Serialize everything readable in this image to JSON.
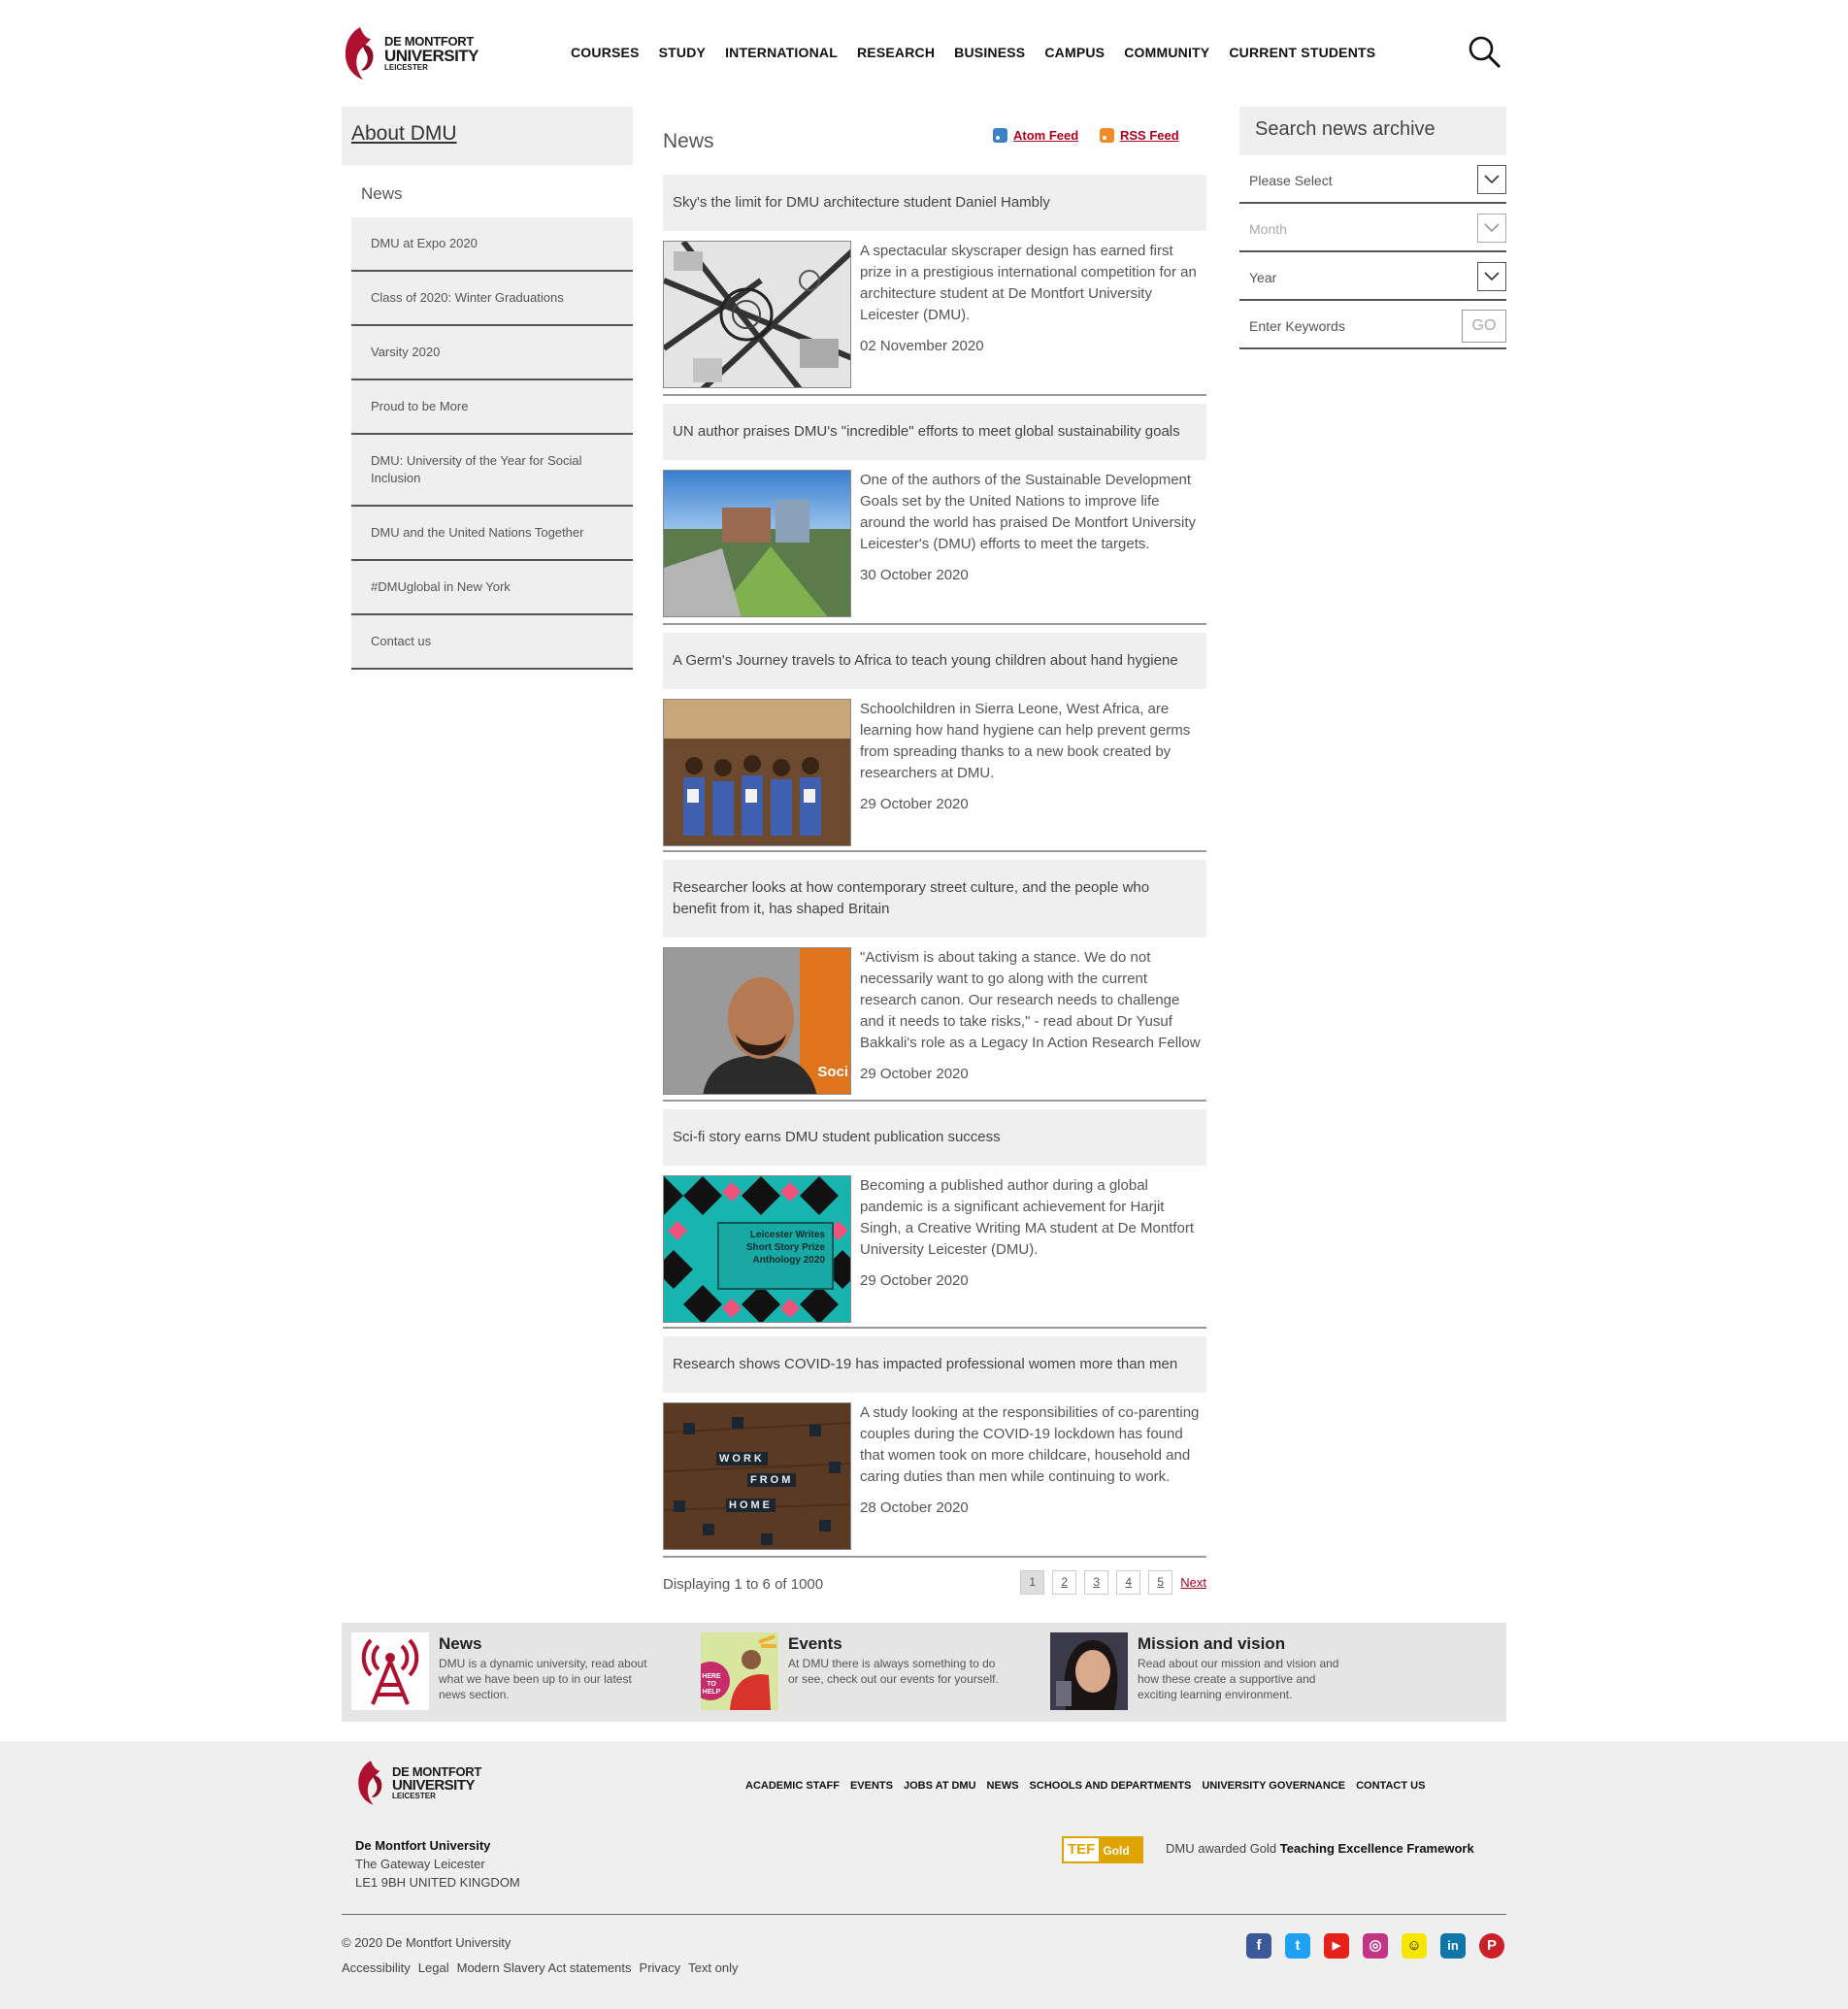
{
  "header": {
    "logo": {
      "line1": "DE MONTFORT",
      "line2": "UNIVERSITY",
      "line3": "LEICESTER"
    },
    "nav": [
      "COURSES",
      "STUDY",
      "INTERNATIONAL",
      "RESEARCH",
      "BUSINESS",
      "CAMPUS",
      "COMMUNITY",
      "CURRENT STUDENTS"
    ],
    "search_icon": "search-icon"
  },
  "sidebar": {
    "about": "About DMU",
    "section": "News",
    "items": [
      "DMU at Expo 2020",
      "Class of 2020: Winter Graduations",
      "Varsity 2020",
      "Proud to be More",
      "DMU: University of the Year for Social Inclusion",
      "DMU and the United Nations Together",
      "#DMUglobal in New York",
      "Contact us"
    ]
  },
  "news": {
    "title": "News",
    "atom": "Atom Feed",
    "rss": "RSS Feed",
    "articles": [
      {
        "headline": "Sky's the limit for DMU architecture student Daniel Hambly",
        "summary": "A spectacular skyscraper design has earned first prize in a prestigious international competition for an architecture student at De Montfort University Leicester (DMU).",
        "date": "02 November 2020"
      },
      {
        "headline": "UN author praises DMU's \"incredible\" efforts to meet global sustainability goals",
        "summary": "One of the authors of the Sustainable Development Goals set by the United Nations to improve life around the world has praised De Montfort University Leicester's (DMU) efforts to meet the targets.",
        "date": "30 October 2020"
      },
      {
        "headline": "A Germ's Journey travels to Africa to teach young children about hand hygiene",
        "summary": "Schoolchildren in Sierra Leone, West Africa, are learning how hand hygiene can help prevent germs from spreading thanks to a new book created by researchers at DMU.",
        "date": "29 October 2020"
      },
      {
        "headline": "Researcher looks at how contemporary street culture, and the people who benefit from it, has shaped Britain",
        "summary": "\"Activism is about taking a stance. We do not necessarily want to go along with the current research canon. Our research needs to challenge and it needs to take risks,\" - read about Dr Yusuf Bakkali's role as a Legacy In Action Research Fellow",
        "date": "29 October 2020",
        "image_text": "Soci"
      },
      {
        "headline": "Sci-fi story earns DMU student publication success",
        "summary": "Becoming a published author during a global pandemic is a significant achievement for Harjit Singh, a Creative Writing MA student at De Montfort University Leicester (DMU).",
        "date": "29 October 2020",
        "image_text": "Leicester Writes Short Story Prize Anthology 2020"
      },
      {
        "headline": "Research shows COVID-19 has impacted professional women more than men",
        "summary": "A study looking at the responsibilities of co-parenting couples during the COVID-19 lockdown has found that women took on more childcare, household and caring duties than men while continuing to work.",
        "date": "28 October 2020",
        "image_words": [
          "WORK",
          "FROM",
          "HOME"
        ]
      }
    ],
    "pager": {
      "display": "Displaying 1 to 6 of 1000",
      "pages": [
        "1",
        "2",
        "3",
        "4",
        "5"
      ],
      "next": "Next"
    }
  },
  "archive": {
    "title": "Search news archive",
    "select": "Please Select",
    "month": "Month",
    "year": "Year",
    "keywords": "Enter Keywords",
    "go": "GO"
  },
  "promo": [
    {
      "title": "News",
      "desc": "DMU is a dynamic university, read about what we have been up to in our latest news section."
    },
    {
      "title": "Events",
      "desc": "At DMU there is always something to do or see, check out our events for yourself.",
      "image_text": "HERE TO HELP"
    },
    {
      "title": "Mission and vision",
      "desc": "Read about our mission and vision and how these create a supportive and exciting learning environment."
    }
  ],
  "footer": {
    "nav": [
      "ACADEMIC STAFF",
      "EVENTS",
      "JOBS AT DMU",
      "NEWS",
      "SCHOOLS AND DEPARTMENTS",
      "UNIVERSITY GOVERNANCE",
      "CONTACT US"
    ],
    "address": {
      "name": "De Montfort University",
      "line1": "The Gateway  Leicester",
      "line2": "LE1 9BH  UNITED KINGDOM"
    },
    "tef": {
      "t1": "TEF",
      "t2": "Gold",
      "text_pre": "DMU awarded Gold ",
      "text_bold": "Teaching Excellence Framework"
    },
    "copyright": "© 2020 De Montfort University",
    "links": [
      "Accessibility",
      "Legal",
      "Modern Slavery Act statements",
      "Privacy",
      "Text only"
    ],
    "social": [
      {
        "name": "facebook-icon",
        "glyph": "f",
        "color": "#3b5998"
      },
      {
        "name": "twitter-icon",
        "glyph": "t",
        "color": "#1da1f2"
      },
      {
        "name": "youtube-icon",
        "glyph": "▶",
        "color": "#e62117"
      },
      {
        "name": "instagram-icon",
        "glyph": "◎",
        "color": "#c13584"
      },
      {
        "name": "snapchat-icon",
        "glyph": "☺",
        "color": "#f7e600"
      },
      {
        "name": "linkedin-icon",
        "glyph": "in",
        "color": "#0e76a8"
      },
      {
        "name": "pinterest-icon",
        "glyph": "P",
        "color": "#cb2027"
      }
    ]
  },
  "colors": {
    "accent": "#b00020",
    "brand": "#b01030",
    "panel": "#efefef"
  }
}
